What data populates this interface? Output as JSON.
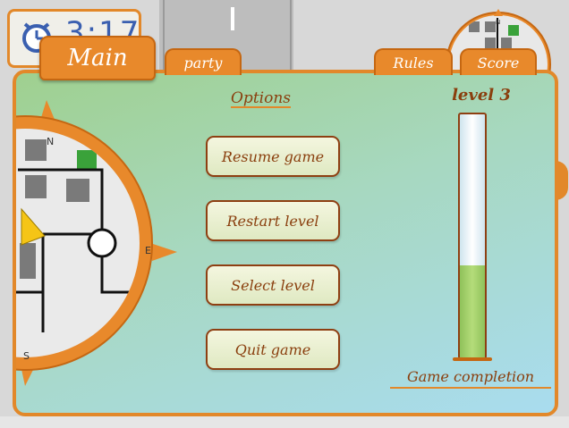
{
  "hud": {
    "time": "3:17"
  },
  "tabs": {
    "main": "Main",
    "party": "party",
    "rules": "Rules",
    "score": "Score"
  },
  "compass": {
    "north": "N",
    "east": "E",
    "south": "S"
  },
  "minimap": {
    "north": "N"
  },
  "options": {
    "title": "Options",
    "buttons": [
      {
        "label": "Resume game"
      },
      {
        "label": "Restart level"
      },
      {
        "label": "Select level"
      },
      {
        "label": "Quit game"
      }
    ]
  },
  "progress": {
    "level_label": "level 3",
    "completion_label": "Game completion",
    "completion_fraction": 0.38
  },
  "colors": {
    "accent": "#e2882a",
    "text": "#8a3f0e",
    "fill": "#a6d46a"
  }
}
